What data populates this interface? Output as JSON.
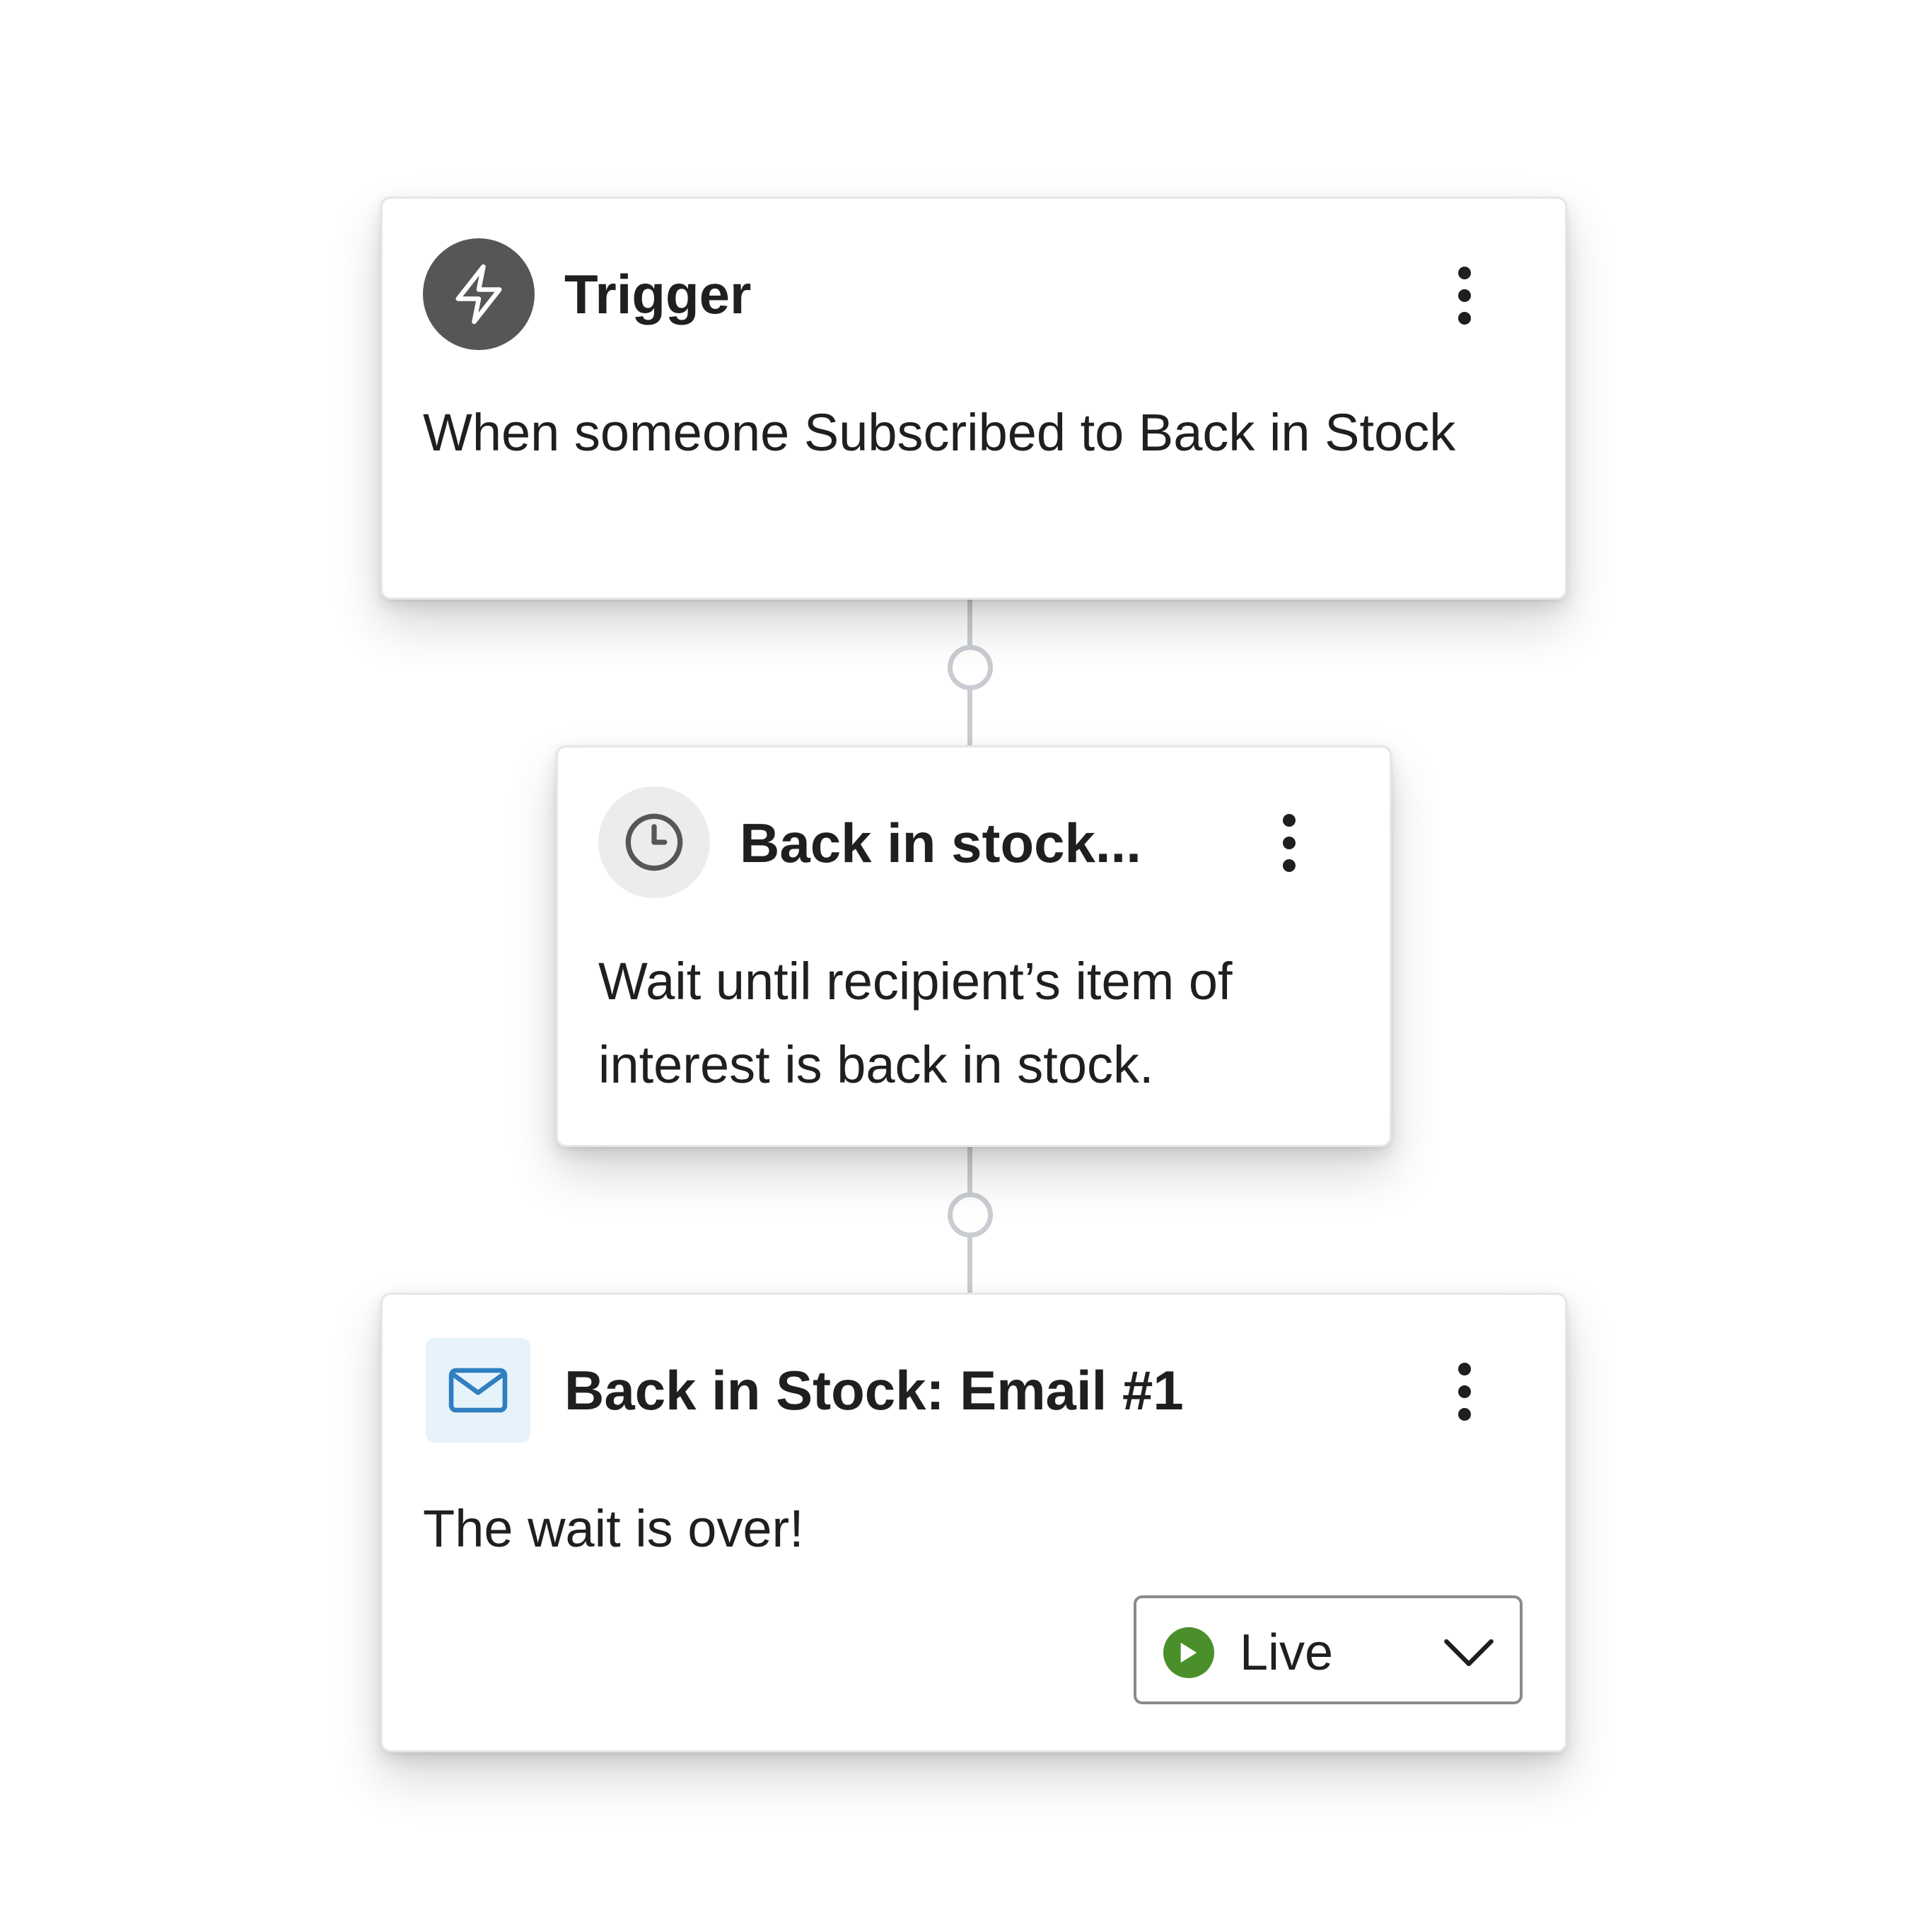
{
  "flow": {
    "trigger": {
      "icon": "lightning-bolt-icon",
      "title": "Trigger",
      "description": "When someone Subscribed to Back in Stock",
      "menu_icon": "more-vertical-icon"
    },
    "wait": {
      "icon": "clock-icon",
      "title": "Back in stock...",
      "description": "Wait until recipient’s item of interest is back in stock.",
      "menu_icon": "more-vertical-icon"
    },
    "email": {
      "icon": "mail-icon",
      "title": "Back in Stock: Email #1",
      "description": "The wait is over!",
      "menu_icon": "more-vertical-icon",
      "status": {
        "label": "Live",
        "icon": "play-circle-icon",
        "dropdown_icon": "chevron-down-icon",
        "color": "#4a8f2a"
      }
    }
  },
  "colors": {
    "trigger_icon_bg": "#555656",
    "clock_icon_bg": "#ececee",
    "mail_icon_bg": "#e7f3fb",
    "mail_icon_stroke": "#2f7fc1",
    "connector": "#c9cdd2"
  }
}
